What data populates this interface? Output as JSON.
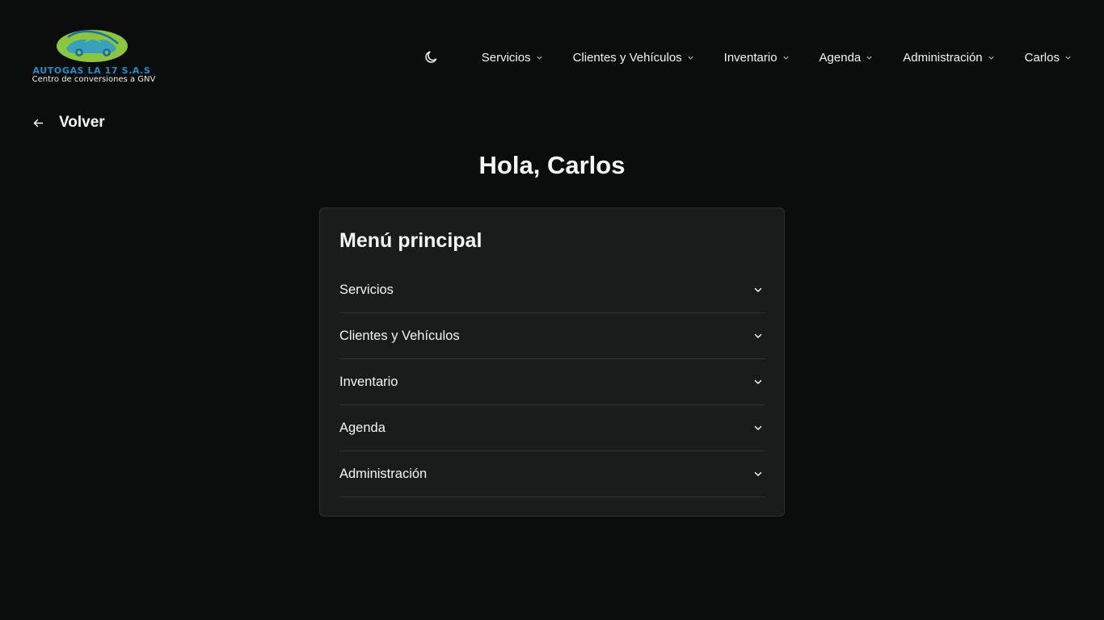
{
  "header": {
    "logo": {
      "title": "AUTOGAS LA 17 S.A.S",
      "subtitle": "Centro de conversiones a GNV"
    },
    "theme_toggle_icon": "moon-icon",
    "nav": [
      {
        "label": "Servicios"
      },
      {
        "label": "Clientes y Vehículos"
      },
      {
        "label": "Inventario"
      },
      {
        "label": "Agenda"
      },
      {
        "label": "Administración"
      },
      {
        "label": "Carlos"
      }
    ]
  },
  "back": {
    "label": "Volver",
    "icon": "arrow-left-icon"
  },
  "greeting": "Hola, Carlos",
  "menu": {
    "title": "Menú principal",
    "items": [
      {
        "label": "Servicios"
      },
      {
        "label": "Clientes y Vehículos"
      },
      {
        "label": "Inventario"
      },
      {
        "label": "Agenda"
      },
      {
        "label": "Administración"
      }
    ]
  },
  "colors": {
    "background": "#0b0d0d",
    "card": "#191c1b",
    "logo_green": "#8cc63f",
    "logo_blue": "#1f8fc9"
  }
}
